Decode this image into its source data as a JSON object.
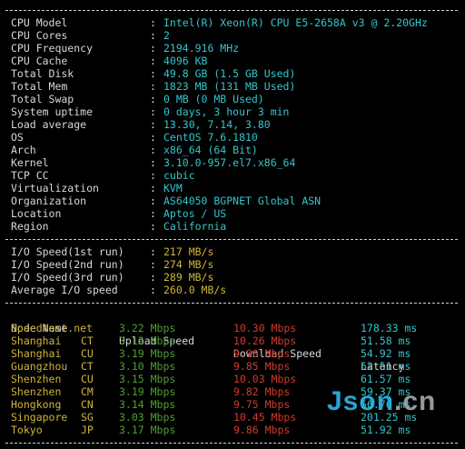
{
  "system_info": [
    {
      "label": "CPU Model",
      "value": "Intel(R) Xeon(R) CPU E5-2658A v3 @ 2.20GHz"
    },
    {
      "label": "CPU Cores",
      "value": "2"
    },
    {
      "label": "CPU Frequency",
      "value": "2194.916 MHz"
    },
    {
      "label": "CPU Cache",
      "value": "4096 KB"
    },
    {
      "label": "Total Disk",
      "value": "49.8 GB (1.5 GB Used)"
    },
    {
      "label": "Total Mem",
      "value": "1823 MB (131 MB Used)"
    },
    {
      "label": "Total Swap",
      "value": "0 MB (0 MB Used)"
    },
    {
      "label": "System uptime",
      "value": "0 days, 3 hour 3 min"
    },
    {
      "label": "Load average",
      "value": "13.30, 7.14, 3.80"
    },
    {
      "label": "OS",
      "value": "CentOS 7.6.1810"
    },
    {
      "label": "Arch",
      "value": "x86_64 (64 Bit)"
    },
    {
      "label": "Kernel",
      "value": "3.10.0-957.el7.x86_64"
    },
    {
      "label": "TCP CC",
      "value": "cubic"
    },
    {
      "label": "Virtualization",
      "value": "KVM"
    },
    {
      "label": "Organization",
      "value": "AS64050 BGPNET Global ASN"
    },
    {
      "label": "Location",
      "value": "Aptos / US"
    },
    {
      "label": "Region",
      "value": "California"
    }
  ],
  "io_speed": [
    {
      "label": "I/O Speed(1st run)",
      "value": "217 MB/s"
    },
    {
      "label": "I/O Speed(2nd run)",
      "value": "274 MB/s"
    },
    {
      "label": "I/O Speed(3rd run)",
      "value": "289 MB/s"
    },
    {
      "label": "Average I/O speed",
      "value": "260.0 MB/s"
    }
  ],
  "separator": ":",
  "speed_table": {
    "headers": {
      "node": "Node Name",
      "upload": "Upload Speed",
      "download": "Download Speed",
      "latency": "Latency"
    },
    "rows": [
      {
        "node": "Speedtest.net",
        "isp": "",
        "upload": "3.22 Mbps",
        "download": "10.30 Mbps",
        "latency": "178.33 ms"
      },
      {
        "node": "Shanghai",
        "isp": "CT",
        "upload": "3.12 Mbps",
        "download": "10.26 Mbps",
        "latency": "51.58 ms"
      },
      {
        "node": "Shanghai",
        "isp": "CU",
        "upload": "3.19 Mbps",
        "download": "9.90 Mbps",
        "latency": "54.92 ms"
      },
      {
        "node": "Guangzhou",
        "isp": "CT",
        "upload": "3.10 Mbps",
        "download": "9.85 Mbps",
        "latency": "52.51 ms"
      },
      {
        "node": "Shenzhen",
        "isp": "CU",
        "upload": "3.15 Mbps",
        "download": "10.03 Mbps",
        "latency": "61.57 ms"
      },
      {
        "node": "Shenzhen",
        "isp": "CM",
        "upload": "3.19 Mbps",
        "download": "9.82 Mbps",
        "latency": "59.37 ms"
      },
      {
        "node": "Hongkong",
        "isp": "CN",
        "upload": "3.14 Mbps",
        "download": "9.75 Mbps",
        "latency": "56.76 ms"
      },
      {
        "node": "Singapore",
        "isp": "SG",
        "upload": "3.03 Mbps",
        "download": "10.45 Mbps",
        "latency": "201.25 ms"
      },
      {
        "node": "Tokyo",
        "isp": "JP",
        "upload": "3.17 Mbps",
        "download": "9.86 Mbps",
        "latency": "51.92 ms"
      }
    ]
  },
  "watermark": {
    "part1": "Json",
    "part2": ".cn"
  },
  "colors": {
    "background": "#000000",
    "label": "#d8d8d8",
    "value": "#33c6cc",
    "io_value": "#d2b43a",
    "node": "#d2b43a",
    "upload": "#4f9f32",
    "download": "#d03a2c",
    "latency": "#33c6cc"
  }
}
